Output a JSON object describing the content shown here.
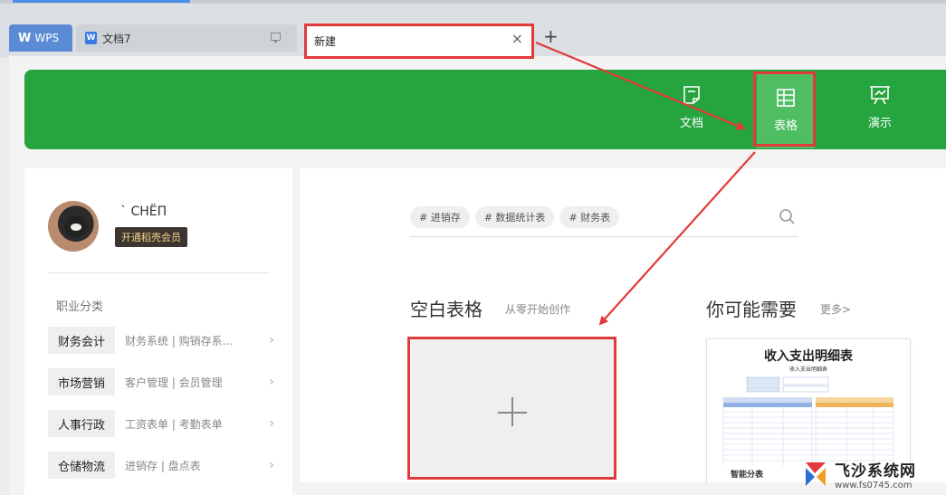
{
  "tabs": {
    "wps_label": "WPS",
    "doc_label": "文档7",
    "doc_badge": "W",
    "new_label": "新建",
    "close_glyph": "×",
    "add_glyph": "+"
  },
  "header_nav": [
    {
      "label": "文档",
      "icon": "document-icon"
    },
    {
      "label": "表格",
      "icon": "table-icon"
    },
    {
      "label": "演示",
      "icon": "presentation-icon"
    }
  ],
  "profile": {
    "username": "` CHЁП",
    "vip_button": "开通稻壳会员"
  },
  "categories": {
    "heading": "职业分类",
    "items": [
      {
        "tag": "财务会计",
        "sub": "财务系统 | 购销存系..."
      },
      {
        "tag": "市场营销",
        "sub": "客户管理 | 会员管理"
      },
      {
        "tag": "人事行政",
        "sub": "工资表单 | 考勤表单"
      },
      {
        "tag": "仓储物流",
        "sub": "进销存 | 盘点表"
      }
    ]
  },
  "search": {
    "chips": [
      "# 进销存",
      "# 数据统计表",
      "# 财务表"
    ]
  },
  "blank_section": {
    "title": "空白表格",
    "subtitle": "从零开始创作"
  },
  "recommend_section": {
    "title": "你可能需要",
    "more": "更多>"
  },
  "template": {
    "title": "收入支出明细表",
    "subtitle": "收入支出明细表",
    "label": "智能分表"
  },
  "watermark": {
    "name": "飞沙系统网",
    "url": "www.fs0745.com"
  },
  "colors": {
    "brand_green": "#26a43f",
    "highlight_red": "#e23a3a",
    "wps_tab_blue": "#5c8bd6"
  }
}
